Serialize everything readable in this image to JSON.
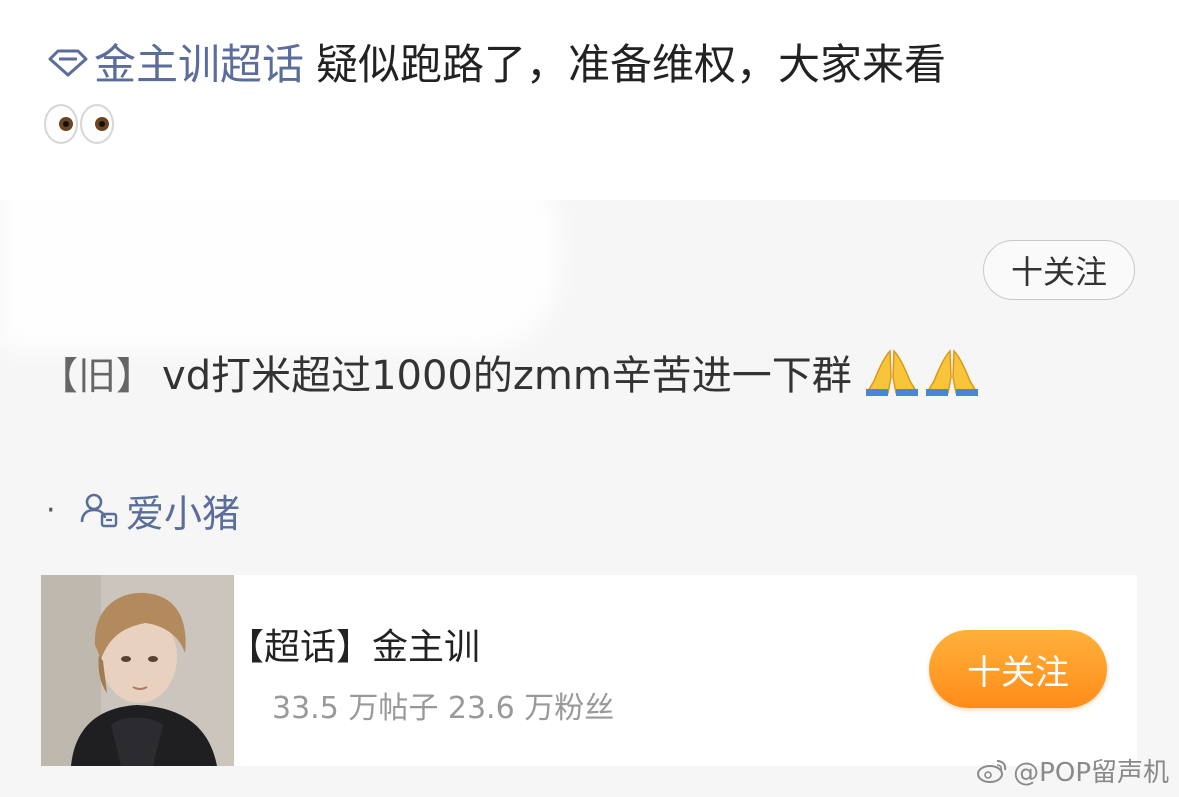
{
  "post": {
    "topic": "金主训超话",
    "text": "疑似跑路了，准备维权，大家来看"
  },
  "follow_small_label": "十关注",
  "quote": {
    "tag": "【旧】",
    "text": "vd打米超过1000的zmm辛苦进一下群"
  },
  "author": {
    "name": "爱小猪"
  },
  "card": {
    "title": "【超话】金主训",
    "stats": "33.5 万帖子 23.6 万粉丝",
    "follow_label": "十关注"
  },
  "watermark": "@POP留声机",
  "icons": [
    "diamond-icon",
    "eyes-emoji",
    "pray-emoji",
    "people-icon",
    "weibo-logo"
  ],
  "colors": {
    "link": "#5b6d9a",
    "follow_orange": "#ff9a26",
    "gray_bg": "#f6f6f6"
  }
}
